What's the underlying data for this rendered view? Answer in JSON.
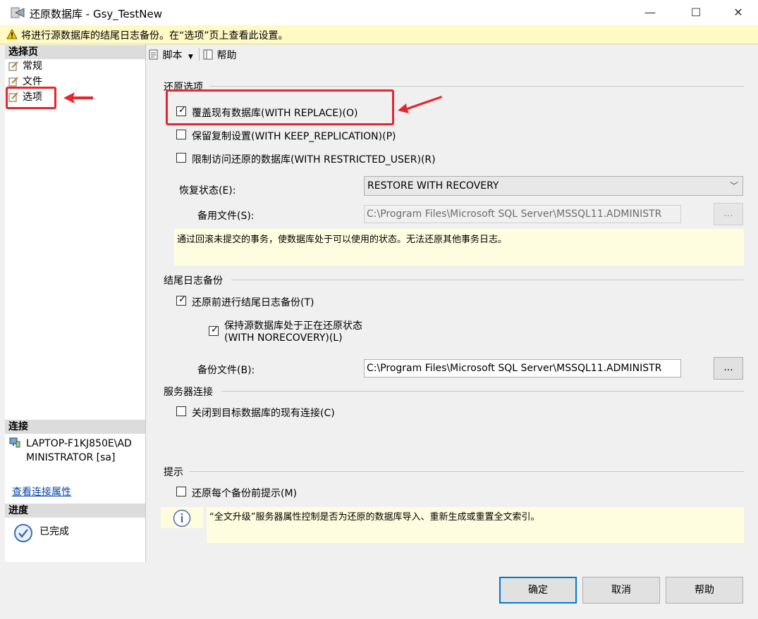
{
  "window": {
    "title": "还原数据库 - Gsy_TestNew",
    "minimize": "—",
    "maximize": "☐",
    "close": "✕"
  },
  "warning": {
    "text": "将进行源数据库的结尾日志备份。在“选项”页上查看此设置。"
  },
  "left": {
    "select_page_header": "选择页",
    "pages": [
      {
        "label": "常规"
      },
      {
        "label": "文件"
      },
      {
        "label": "选项"
      }
    ],
    "connection_header": "连接",
    "connection_line1": "LAPTOP-F1KJ850E\\AD",
    "connection_line2": "MINISTRATOR [sa]",
    "view_conn_link": "查看连接属性",
    "progress_header": "进度",
    "progress_status": "已完成"
  },
  "toolbar": {
    "script_label": "脚本",
    "help_label": "帮助"
  },
  "restore_options": {
    "title": "还原选项",
    "with_replace": {
      "label": "覆盖现有数据库(WITH REPLACE)(O)",
      "checked": true
    },
    "keep_replication": {
      "label": "保留复制设置(WITH KEEP_REPLICATION)(P)",
      "checked": false
    },
    "restricted_user": {
      "label": "限制访问还原的数据库(WITH RESTRICTED_USER)(R)",
      "checked": false
    },
    "recovery_state_label": "恢复状态(E):",
    "recovery_state_value": "RESTORE WITH RECOVERY",
    "standby_file_label": "备用文件(S):",
    "standby_file_value": "C:\\Program Files\\Microsoft SQL Server\\MSSQL11.ADMINISTR",
    "browse_label": "...",
    "description": "通过回滚未提交的事务，使数据库处于可以使用的状态。无法还原其他事务日志。"
  },
  "tail_log": {
    "title": "结尾日志备份",
    "backup_before": {
      "label": "还原前进行结尾日志备份(T)",
      "checked": true
    },
    "norecovery_line1": "保持源数据库处于正在还原状态",
    "norecovery_line2": "(WITH NORECOVERY)(L)",
    "norecovery_checked": true,
    "backup_file_label": "备份文件(B):",
    "backup_file_value": "C:\\Program Files\\Microsoft SQL Server\\MSSQL11.ADMINISTR",
    "browse_label": "..."
  },
  "server_conn": {
    "title": "服务器连接",
    "close_existing": {
      "label": "关闭到目标数据库的现有连接(C)",
      "checked": false
    }
  },
  "prompt": {
    "title": "提示",
    "prompt_before": {
      "label": "还原每个备份前提示(M)",
      "checked": false
    },
    "info_text": "“全文升级”服务器属性控制是否为还原的数据库导入、重新生成或重置全文索引。"
  },
  "buttons": {
    "ok": "确定",
    "cancel": "取消",
    "help": "帮助"
  },
  "check_mark": "✓",
  "colors": {
    "annotation_red": "#e8252b",
    "warning_bg": "#fff9c4",
    "info_bg": "#fffde0"
  }
}
